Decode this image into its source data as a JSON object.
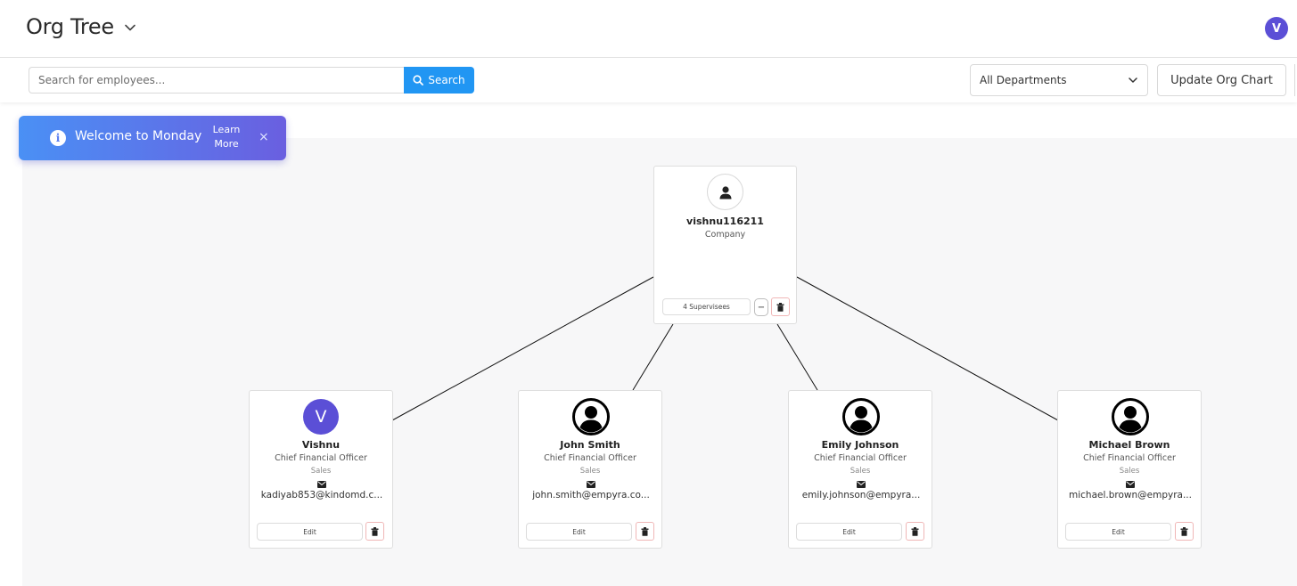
{
  "header": {
    "title": "Org Tree",
    "user_initial": "V",
    "avatar_color": "#5b4fd6"
  },
  "toolbar": {
    "search_placeholder": "Search for employees...",
    "search_value": "",
    "search_label": "Search",
    "department_selected": "All Departments",
    "update_label": "Update Org Chart",
    "accent_color": "#2196f3"
  },
  "toast": {
    "message": "Welcome to Monday",
    "learn_more": "Learn More",
    "close": "×"
  },
  "root": {
    "name": "vishnu116211",
    "type": "Company",
    "supervisees_label": "4 Supervisees",
    "collapse_symbol": "−"
  },
  "employees": [
    {
      "name": "Vishnu",
      "title": "Chief Financial Officer",
      "department": "Sales",
      "email": "kadiyab853@kindomd.c...",
      "avatar_letter": "V",
      "edit_label": "Edit"
    },
    {
      "name": "John Smith",
      "title": "Chief Financial Officer",
      "department": "Sales",
      "email": "john.smith@empyra.co...",
      "avatar_letter": "",
      "edit_label": "Edit"
    },
    {
      "name": "Emily Johnson",
      "title": "Chief Financial Officer",
      "department": "Sales",
      "email": "emily.johnson@empyra...",
      "avatar_letter": "",
      "edit_label": "Edit"
    },
    {
      "name": "Michael Brown",
      "title": "Chief Financial Officer",
      "department": "Sales",
      "email": "michael.brown@empyra...",
      "avatar_letter": "",
      "edit_label": "Edit"
    }
  ]
}
